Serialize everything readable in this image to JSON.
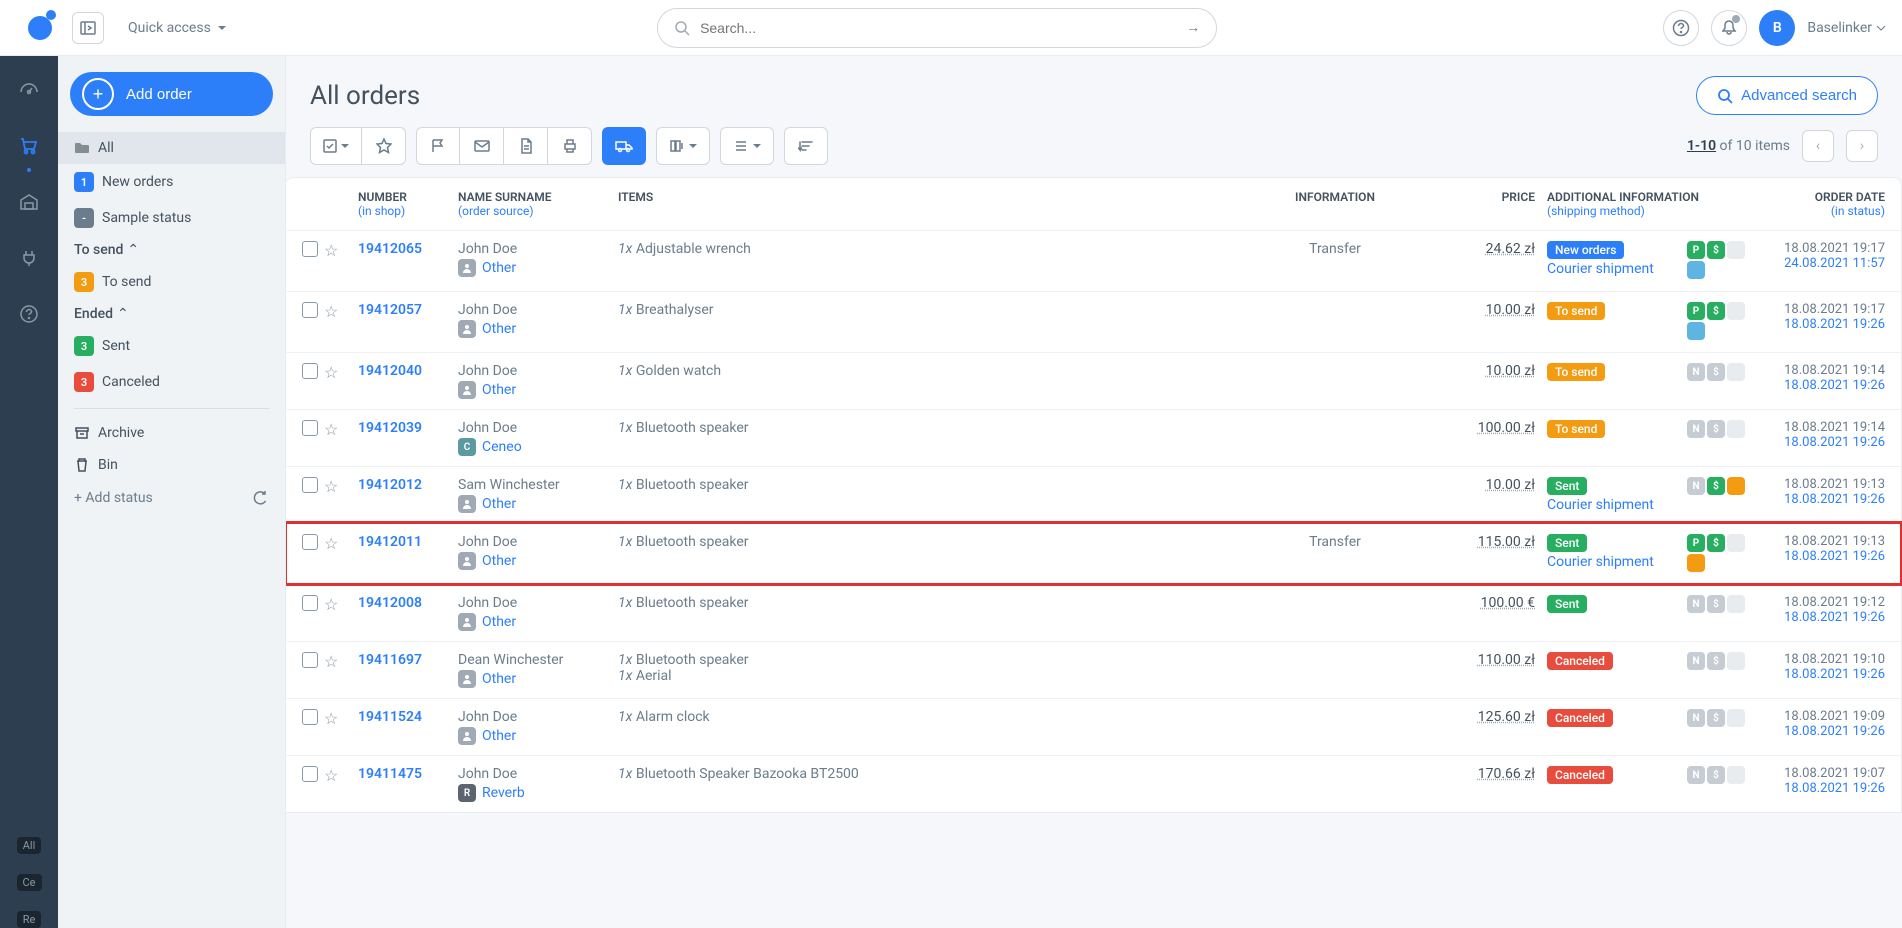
{
  "topbar": {
    "quick_access": "Quick access",
    "search_placeholder": "Search...",
    "user_initial": "B",
    "user_name": "Baselinker"
  },
  "sidebar": {
    "add_order": "Add order",
    "all": "All",
    "items": [
      {
        "badge": "1",
        "badge_color": "blue",
        "label": "New orders"
      },
      {
        "badge": "-",
        "badge_color": "grey",
        "label": "Sample status"
      }
    ],
    "group_tosend": "To send",
    "tosend": {
      "badge": "3",
      "badge_color": "orange",
      "label": "To send"
    },
    "group_ended": "Ended",
    "ended": [
      {
        "badge": "3",
        "badge_color": "green",
        "label": "Sent"
      },
      {
        "badge": "3",
        "badge_color": "red",
        "label": "Canceled"
      }
    ],
    "archive": "Archive",
    "bin": "Bin",
    "add_status": "+ Add status"
  },
  "main": {
    "title": "All orders",
    "adv_search": "Advanced search",
    "page_range": "1-10",
    "page_of": " of 10 items"
  },
  "rail_badges": [
    "All",
    "Ce",
    "Re"
  ],
  "table": {
    "headers": {
      "number": "NUMBER",
      "number_sub": "(in shop)",
      "name": "NAME SURNAME",
      "name_sub": "(order source)",
      "items": "ITEMS",
      "info": "INFORMATION",
      "price": "PRICE",
      "addl": "ADDITIONAL INFORMATION",
      "addl_sub": "(shipping method)",
      "date": "ORDER DATE",
      "date_sub": "(in status)"
    },
    "rows": [
      {
        "num": "19412065",
        "name": "John Doe",
        "src": "Other",
        "src_badge": "grey",
        "src_letter": "",
        "items": [
          {
            "q": "1x",
            "n": "Adjustable wrench"
          }
        ],
        "info": "Transfer",
        "price": "24.62 zł",
        "status": "New orders",
        "status_c": "blue",
        "ship": "Courier shipment",
        "flags": [
          {
            "t": "P",
            "c": "green"
          },
          {
            "t": "$",
            "c": "green"
          },
          {
            "t": "",
            "c": "light"
          }
        ],
        "flags2": [
          {
            "t": "",
            "c": "lightblue"
          }
        ],
        "d1": "18.08.2021 19:17",
        "d2": "24.08.2021 11:57",
        "hl": false
      },
      {
        "num": "19412057",
        "name": "John Doe",
        "src": "Other",
        "src_badge": "grey",
        "src_letter": "",
        "items": [
          {
            "q": "1x",
            "n": "Breathalyser"
          }
        ],
        "info": "",
        "price": "10.00 zł",
        "status": "To send",
        "status_c": "orange",
        "ship": "",
        "flags": [
          {
            "t": "P",
            "c": "green"
          },
          {
            "t": "$",
            "c": "green"
          },
          {
            "t": "",
            "c": "light"
          }
        ],
        "flags2": [
          {
            "t": "",
            "c": "lightblue"
          }
        ],
        "d1": "18.08.2021 19:17",
        "d2": "18.08.2021 19:26",
        "hl": false
      },
      {
        "num": "19412040",
        "name": "John Doe",
        "src": "Other",
        "src_badge": "grey",
        "src_letter": "",
        "items": [
          {
            "q": "1x",
            "n": "Golden watch"
          }
        ],
        "info": "",
        "price": "10.00 zł",
        "status": "To send",
        "status_c": "orange",
        "ship": "",
        "flags": [
          {
            "t": "N",
            "c": "grey"
          },
          {
            "t": "$",
            "c": "grey"
          },
          {
            "t": "",
            "c": "light"
          }
        ],
        "flags2": [],
        "d1": "18.08.2021 19:14",
        "d2": "18.08.2021 19:26",
        "hl": false
      },
      {
        "num": "19412039",
        "name": "John Doe",
        "src": "Ceneo",
        "src_badge": "teal",
        "src_letter": "C",
        "items": [
          {
            "q": "1x",
            "n": "Bluetooth speaker"
          }
        ],
        "info": "",
        "price": "100.00 zł",
        "status": "To send",
        "status_c": "orange",
        "ship": "",
        "flags": [
          {
            "t": "N",
            "c": "grey"
          },
          {
            "t": "$",
            "c": "grey"
          },
          {
            "t": "",
            "c": "light"
          }
        ],
        "flags2": [],
        "d1": "18.08.2021 19:14",
        "d2": "18.08.2021 19:26",
        "hl": false
      },
      {
        "num": "19412012",
        "name": "Sam Winchester",
        "src": "Other",
        "src_badge": "grey",
        "src_letter": "",
        "items": [
          {
            "q": "1x",
            "n": "Bluetooth speaker"
          }
        ],
        "info": "",
        "price": "10.00 zł",
        "status": "Sent",
        "status_c": "green",
        "ship": "Courier shipment",
        "flags": [
          {
            "t": "N",
            "c": "grey"
          },
          {
            "t": "$",
            "c": "green"
          },
          {
            "t": "",
            "c": "orange"
          }
        ],
        "flags2": [],
        "d1": "18.08.2021 19:13",
        "d2": "18.08.2021 19:26",
        "hl": false
      },
      {
        "num": "19412011",
        "name": "John Doe",
        "src": "Other",
        "src_badge": "grey",
        "src_letter": "",
        "items": [
          {
            "q": "1x",
            "n": "Bluetooth speaker"
          }
        ],
        "info": "Transfer",
        "price": "115.00 zł",
        "status": "Sent",
        "status_c": "green",
        "ship": "Courier shipment",
        "flags": [
          {
            "t": "P",
            "c": "green"
          },
          {
            "t": "$",
            "c": "green"
          },
          {
            "t": "",
            "c": "light"
          }
        ],
        "flags2": [
          {
            "t": "",
            "c": "orange"
          }
        ],
        "d1": "18.08.2021 19:13",
        "d2": "18.08.2021 19:26",
        "hl": true
      },
      {
        "num": "19412008",
        "name": "John Doe",
        "src": "Other",
        "src_badge": "grey",
        "src_letter": "",
        "items": [
          {
            "q": "1x",
            "n": "Bluetooth speaker"
          }
        ],
        "info": "",
        "price": "100.00 €",
        "status": "Sent",
        "status_c": "green",
        "ship": "",
        "flags": [
          {
            "t": "N",
            "c": "grey"
          },
          {
            "t": "$",
            "c": "grey"
          },
          {
            "t": "",
            "c": "light"
          }
        ],
        "flags2": [],
        "d1": "18.08.2021 19:12",
        "d2": "18.08.2021 19:26",
        "hl": false
      },
      {
        "num": "19411697",
        "name": "Dean Winchester",
        "src": "Other",
        "src_badge": "grey",
        "src_letter": "",
        "items": [
          {
            "q": "1x",
            "n": "Bluetooth speaker"
          },
          {
            "q": "1x",
            "n": "Aerial"
          }
        ],
        "info": "",
        "price": "110.00 zł",
        "status": "Canceled",
        "status_c": "red",
        "ship": "",
        "flags": [
          {
            "t": "N",
            "c": "grey"
          },
          {
            "t": "$",
            "c": "grey"
          },
          {
            "t": "",
            "c": "light"
          }
        ],
        "flags2": [],
        "d1": "18.08.2021 19:10",
        "d2": "18.08.2021 19:26",
        "hl": false
      },
      {
        "num": "19411524",
        "name": "John Doe",
        "src": "Other",
        "src_badge": "grey",
        "src_letter": "",
        "items": [
          {
            "q": "1x",
            "n": "Alarm clock"
          }
        ],
        "info": "",
        "price": "125.60 zł",
        "status": "Canceled",
        "status_c": "red",
        "ship": "",
        "flags": [
          {
            "t": "N",
            "c": "grey"
          },
          {
            "t": "$",
            "c": "grey"
          },
          {
            "t": "",
            "c": "light"
          }
        ],
        "flags2": [],
        "d1": "18.08.2021 19:09",
        "d2": "18.08.2021 19:26",
        "hl": false
      },
      {
        "num": "19411475",
        "name": "John Doe",
        "src": "Reverb",
        "src_badge": "dark",
        "src_letter": "R",
        "items": [
          {
            "q": "1x",
            "n": "Bluetooth Speaker Bazooka BT2500"
          }
        ],
        "info": "",
        "price": "170.66 zł",
        "status": "Canceled",
        "status_c": "red",
        "ship": "",
        "flags": [
          {
            "t": "N",
            "c": "grey"
          },
          {
            "t": "$",
            "c": "grey"
          },
          {
            "t": "",
            "c": "light"
          }
        ],
        "flags2": [],
        "d1": "18.08.2021 19:07",
        "d2": "18.08.2021 19:26",
        "hl": false
      }
    ]
  }
}
